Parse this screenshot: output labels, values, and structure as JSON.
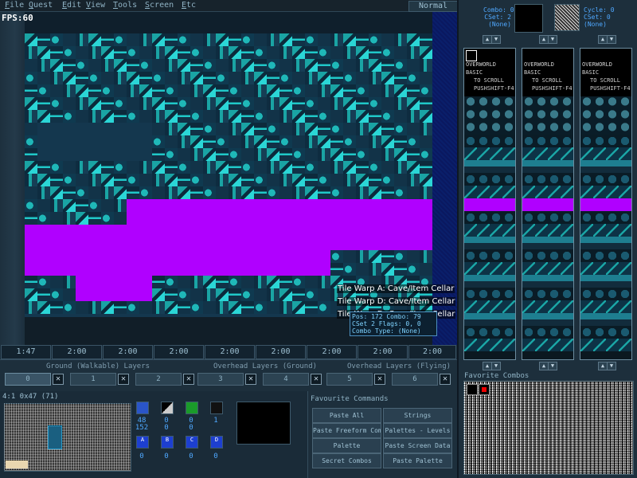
{
  "menubar": {
    "items": [
      "File",
      "Quest",
      "Edit",
      "View",
      "Tools",
      "Screen",
      "Etc"
    ],
    "mode": "Normal"
  },
  "fps": "FPS:60",
  "map": {
    "warp_lines": [
      "Tile Warp A: Cave/Item Cellar",
      "Tile Warp D: Cave/Item Cellar",
      "Tile Warp D: Cave/Item Cellar"
    ],
    "combo_tip": [
      "Pos: 172 Combo: 79",
      "CSet 2 Flags: 0, 0",
      "Combo Type: (None)"
    ],
    "colors": {
      "magenta": "#b000ff",
      "teal": "#1aa4a4",
      "deep_blue": "#14374e"
    }
  },
  "status_cells": [
    "1:47",
    "2:00",
    "2:00",
    "2:00",
    "2:00",
    "2:00",
    "2:00",
    "2:00",
    "2:00"
  ],
  "layers": {
    "ground_label": "Ground (Walkable) Layers",
    "overhead_ground_label": "Overhead Layers (Ground)",
    "overhead_flying_label": "Overhead Layers (Flying)",
    "buttons": [
      "0",
      "1",
      "2",
      "3",
      "4",
      "5",
      "6"
    ]
  },
  "minimap": {
    "label": "4:1    0x47 (71)"
  },
  "items": {
    "top_row": [
      {
        "icon": "shield-item-icon",
        "nums": [
          "48",
          "152"
        ]
      },
      {
        "icon": "stairs-item-icon",
        "nums": [
          "0",
          "0"
        ]
      },
      {
        "icon": "green-rupee-item-icon",
        "nums": [
          "0",
          "0"
        ]
      },
      {
        "icon": "creature-item-icon",
        "nums": [
          "1",
          ""
        ]
      }
    ],
    "bottom_row": [
      {
        "letter": "A",
        "num": "0"
      },
      {
        "letter": "B",
        "num": "0"
      },
      {
        "letter": "C",
        "num": "0"
      },
      {
        "letter": "D",
        "num": "0"
      }
    ]
  },
  "favorite_commands": {
    "title": "Favourite Commands",
    "buttons": [
      "Paste All",
      "Strings",
      "Paste Freeform Combos",
      "Palettes - Levels",
      "Palette",
      "Paste Screen Data",
      "Secret Combos",
      "Paste Palette"
    ]
  },
  "right_panel": {
    "combo_info": [
      "Combo: 0",
      "CSet: 2",
      "(None)"
    ],
    "cycle_info": [
      "Cycle: 0",
      "CSet: 0",
      "(None)"
    ],
    "column_text": [
      "OVERWORLD",
      "BASIC",
      "TO SCROLL",
      "PUSHSHIFT-F4"
    ],
    "favorite_combos_label": "Favorite Combos"
  }
}
